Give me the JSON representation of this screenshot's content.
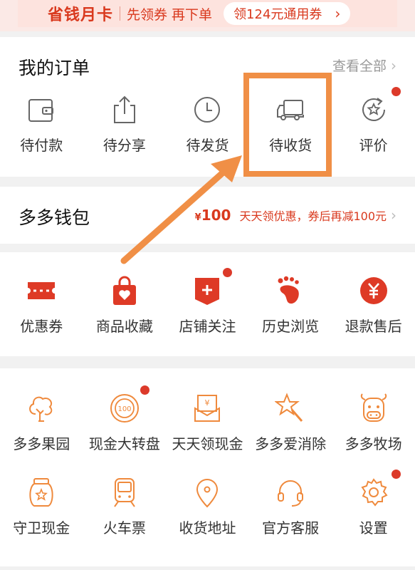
{
  "banner": {
    "title": "省钱月卡",
    "subtitle": "先领券 再下单",
    "pill": "领124元通用券",
    "chevron": "›"
  },
  "orders": {
    "title": "我的订单",
    "view_all": "查看全部",
    "chevron": "›",
    "items": [
      {
        "label": "待付款",
        "icon": "wallet-icon"
      },
      {
        "label": "待分享",
        "icon": "share-icon"
      },
      {
        "label": "待发货",
        "icon": "clock-icon"
      },
      {
        "label": "待收货",
        "icon": "truck-icon"
      },
      {
        "label": "评价",
        "icon": "review-icon",
        "badge": true
      }
    ]
  },
  "wallet": {
    "title": "多多钱包",
    "amount_symbol": "¥",
    "amount": "100",
    "promo": "天天领优惠，券后再减100元",
    "chevron": "›"
  },
  "services": {
    "items": [
      {
        "label": "优惠券",
        "icon": "coupon-icon"
      },
      {
        "label": "商品收藏",
        "icon": "favorites-bag-icon"
      },
      {
        "label": "店铺关注",
        "icon": "store-follow-icon",
        "badge": true
      },
      {
        "label": "历史浏览",
        "icon": "footprint-icon"
      },
      {
        "label": "退款售后",
        "icon": "refund-icon"
      }
    ]
  },
  "tools": {
    "row1": [
      {
        "label": "多多果园",
        "icon": "tree-icon"
      },
      {
        "label": "现金大转盘",
        "icon": "spin-wheel-icon",
        "badge": true,
        "icon_text": "100"
      },
      {
        "label": "天天领现金",
        "icon": "cash-envelope-icon",
        "icon_text": "¥"
      },
      {
        "label": "多多爱消除",
        "icon": "star-wand-icon"
      },
      {
        "label": "多多牧场",
        "icon": "cow-icon"
      }
    ],
    "row2": [
      {
        "label": "守卫现金",
        "icon": "jar-icon"
      },
      {
        "label": "火车票",
        "icon": "train-icon"
      },
      {
        "label": "收货地址",
        "icon": "location-pin-icon"
      },
      {
        "label": "官方客服",
        "icon": "headset-icon"
      },
      {
        "label": "设置",
        "icon": "settings-gear-icon",
        "badge": true
      }
    ]
  },
  "colors": {
    "brand_red": "#d9391e",
    "orange": "#f08f46",
    "badge": "#dc3a2a"
  }
}
